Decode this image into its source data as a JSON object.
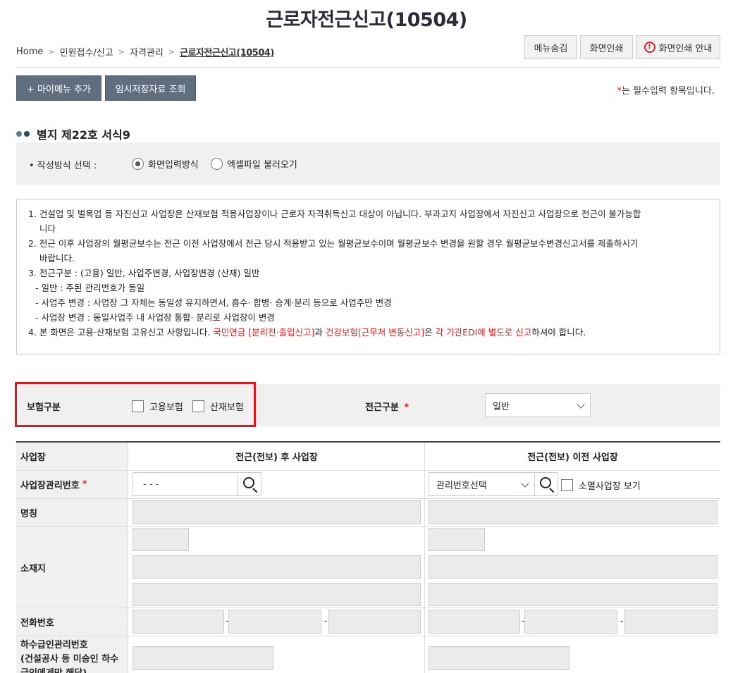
{
  "page": {
    "title": "근로자전근신고(10504)"
  },
  "breadcrumb": {
    "items": [
      "Home",
      "민원접수/신고",
      "자격관리"
    ],
    "current": "근로자전근신고(10504)"
  },
  "top_buttons": {
    "hide_menu": "메뉴숨김",
    "print": "화면인쇄",
    "print_guide": "화면인쇄 안내"
  },
  "actions": {
    "add_my_menu": "+ 마이메뉴 추가",
    "temp_saved": "임시저장자료 조회"
  },
  "required_note": {
    "mark": "*",
    "text": "는 필수입력 항목입니다."
  },
  "section": {
    "title": "별지 제22호 서식9"
  },
  "method": {
    "label": "• 작성방식 선택 :",
    "options": [
      "화면입력방식",
      "엑셀파일 불러오기"
    ],
    "selected": "화면입력방식"
  },
  "notice": {
    "item1": "1. 건설업 및 벌목업 등 자진신고 사업장은 산재보험 적용사업장이나 근로자 자격취득신고 대상이 아닙니다. 부과고지 사업장에서 자진신고 사업장으로 전근이 불가능합",
    "item1b": "니다",
    "item2": "2. 전근 이후 사업장의 월평균보수는 전근 이전 사업장에서 전근 당시 적용받고 있는 월평균보수이며 월평균보수 변경을 원할 경우 월평균보수변경신고서를 제출하시기",
    "item2b": "바랍니다.",
    "item3": "3. 전근구분 : (고용) 일반, 사업주변경, 사업장변경 (산재) 일반",
    "item3a": "- 일반 : 주된 관리번호가 동일",
    "item3b": "- 사업주 변경 : 사업장 그 자체는 동일성 유지하면서, 흡수· 합병· 승계·분리 등으로 사업주만 변경",
    "item3c": "- 사업장 변경 : 동일사업주 내 사업장 통합· 분리로 사업장이 변경",
    "item4_a": "4. 본 화면은 고용·산재보험 고유신고 사항입니다. ",
    "item4_b": "국민연금 [분리전·출입신고]",
    "item4_c": "과 ",
    "item4_d": "건강보험[근무처 변동신고]",
    "item4_e": "은 ",
    "item4_f": "각 기관EDI에 별도로 신고",
    "item4_g": "하셔야 합니다."
  },
  "insurance": {
    "label": "보험구분",
    "options": [
      "고용보험",
      "산재보험"
    ],
    "transfer_label": "전근구분",
    "transfer_required": "*",
    "transfer_value": "일반"
  },
  "table": {
    "headers": {
      "col0": "사업장",
      "col1": "전근(전보) 후 사업장",
      "col2": "전근(전보) 이전 사업장"
    },
    "rows": {
      "mgmt_no": "사업장관리번호",
      "mgmt_required": "*",
      "mgmt_placeholder": "-  -  -",
      "mgmt_select": "관리번호선택",
      "closed_label": "소멸사업장 보기",
      "name": "명칭",
      "address": "소재지",
      "phone": "전화번호",
      "phone_sep": "-",
      "subcontract": "하수급인관리번호",
      "subcontract_sub": "(건설공사 등 미승인 하수",
      "subcontract_sub2": "급인에게만 해당)"
    }
  },
  "colors": {
    "accent_button": "#5f6f7f",
    "highlight": "#e0161e",
    "required": "#e02020"
  }
}
